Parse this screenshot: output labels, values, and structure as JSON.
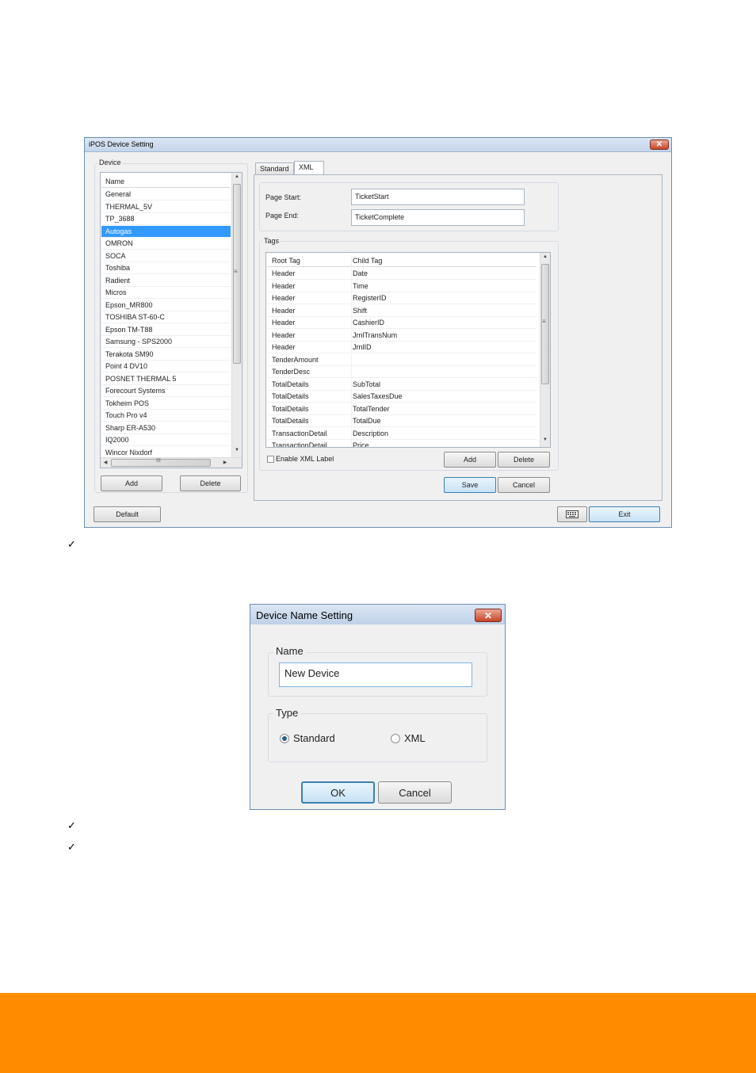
{
  "window1": {
    "title": "iPOS Device Setting",
    "close_glyph": "✕",
    "device_group_label": "Device",
    "device_list": {
      "header": "Name",
      "items": [
        "General",
        "THERMAL_5V",
        "TP_3688",
        "Autogas",
        "OMRON",
        "SOCA",
        "Toshiba",
        "Radient",
        "Micros",
        "Epson_MR800",
        "TOSHIBA ST-60-C",
        "Epson TM-T88",
        "Samsung - SPS2000",
        "Terakota SM90",
        "Point 4 DV10",
        "POSNET THERMAL 5",
        "Forecourt Systems",
        "Tokheim POS",
        "Touch Pro v4",
        "Sharp ER-A530",
        "IQ2000",
        "Wincor Nixdorf"
      ],
      "selected": "Autogas",
      "hscroll_mark": "III",
      "vscroll_mark": "≡"
    },
    "add_label": "Add",
    "delete_label": "Delete",
    "tabs": [
      "Standard",
      "XML"
    ],
    "active_tab": "XML",
    "page_start_label": "Page Start:",
    "page_start_value": "TicketStart",
    "page_end_label": "Page End:",
    "page_end_value": "TicketComplete",
    "tags_group_label": "Tags",
    "tags_grid": {
      "headers": [
        "Root Tag",
        "Child Tag"
      ],
      "rows": [
        [
          "Header",
          "Date"
        ],
        [
          "Header",
          "Time"
        ],
        [
          "Header",
          "RegisterID"
        ],
        [
          "Header",
          "Shift"
        ],
        [
          "Header",
          "CashierID"
        ],
        [
          "Header",
          "JrnlTransNum"
        ],
        [
          "Header",
          "JrnlID"
        ],
        [
          "TenderAmount",
          ""
        ],
        [
          "TenderDesc",
          ""
        ],
        [
          "TotalDetails",
          "SubTotal"
        ],
        [
          "TotalDetails",
          "SalesTaxesDue"
        ],
        [
          "TotalDetails",
          "TotalTender"
        ],
        [
          "TotalDetails",
          "TotalDue"
        ],
        [
          "TransactionDetail",
          "Description"
        ],
        [
          "TransactionDetail",
          "Price"
        ]
      ]
    },
    "enable_xml_label": "Enable XML Label",
    "tags_add_label": "Add",
    "tags_delete_label": "Delete",
    "save_label": "Save",
    "cancel_label": "Cancel",
    "default_label": "Default",
    "exit_label": "Exit",
    "keyboard_icon": "keyboard-icon"
  },
  "window2": {
    "title": "Device Name Setting",
    "close_glyph": "✕",
    "name_group_label": "Name",
    "name_value": "New Device",
    "type_group_label": "Type",
    "type_options": [
      "Standard",
      "XML"
    ],
    "type_selected": "Standard",
    "ok_label": "OK",
    "cancel_label": "Cancel"
  },
  "checkmark_glyph": "✓",
  "colors": {
    "footer": "#ff8c00",
    "selection": "#3399ff",
    "title_close": "#c7452a"
  }
}
